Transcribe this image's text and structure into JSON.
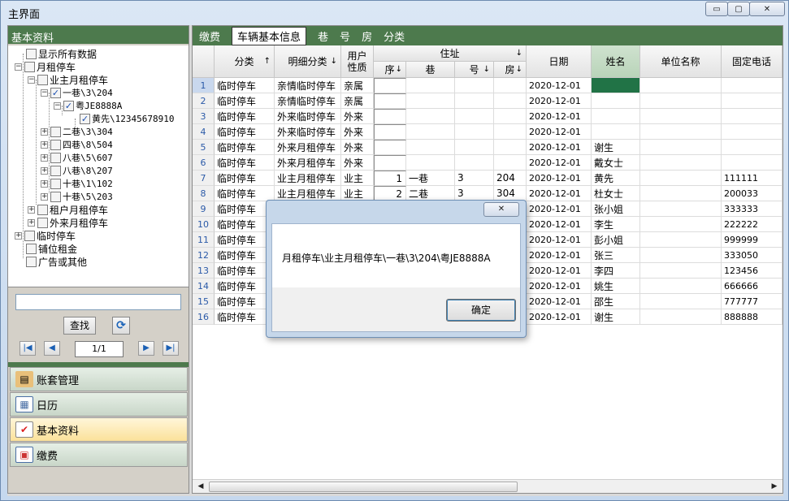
{
  "window": {
    "title": "主界面",
    "minimize_glyph": "▭",
    "maximize_glyph": "▢",
    "close_glyph": "✕"
  },
  "left": {
    "header": "基本资料",
    "tree": [
      {
        "label": "显示所有数据",
        "checked": false
      },
      {
        "label": "月租停车",
        "checked": false
      },
      {
        "label": "业主月租停车",
        "checked": false
      },
      {
        "label": "一巷\\3\\204",
        "checked": true
      },
      {
        "label": "粤JE8888A",
        "checked": true
      },
      {
        "label": "黄先\\12345678910",
        "checked": true
      },
      {
        "label": "二巷\\3\\304",
        "checked": false
      },
      {
        "label": "四巷\\8\\504",
        "checked": false
      },
      {
        "label": "八巷\\5\\607",
        "checked": false
      },
      {
        "label": "八巷\\8\\207",
        "checked": false
      },
      {
        "label": "十巷\\1\\102",
        "checked": false
      },
      {
        "label": "十巷\\5\\203",
        "checked": false
      },
      {
        "label": "租户月租停车",
        "checked": false
      },
      {
        "label": "外来月租停车",
        "checked": false
      },
      {
        "label": "临时停车",
        "checked": false
      },
      {
        "label": "铺位租金",
        "checked": false
      },
      {
        "label": "广告或其他",
        "checked": false
      }
    ],
    "search_value": "",
    "find_label": "查找",
    "refresh_glyph": "⟳",
    "nav_first": "|◀",
    "nav_prev": "◀",
    "nav_next": "▶",
    "nav_last": "▶|",
    "page_indicator": "1/1",
    "menu": [
      {
        "label": "账套管理",
        "icon": "ledger-icon"
      },
      {
        "label": "日历",
        "icon": "calendar-icon"
      },
      {
        "label": "基本资料",
        "icon": "checklist-icon"
      },
      {
        "label": "缴费",
        "icon": "payment-card-icon"
      }
    ]
  },
  "tabs": [
    "缴费",
    "车辆基本信息",
    "巷",
    "号",
    "房",
    "分类"
  ],
  "grid": {
    "headers": {
      "category": "分类",
      "detail": "明细分类",
      "user_type_1": "用户",
      "user_type_2": "性质",
      "address": "住址",
      "seq": "序",
      "lane": "巷",
      "number": "号",
      "room": "房",
      "date": "日期",
      "name": "姓名",
      "company": "单位名称",
      "phone": "固定电话"
    },
    "sort_up": "↑",
    "sort_down": "↓",
    "rows": [
      {
        "n": "1",
        "category": "临时停车",
        "detail": "亲情临时停车",
        "user": "亲属",
        "seq": "",
        "lane": "",
        "number": "",
        "room": "",
        "date": "2020-12-01",
        "name": "",
        "company": "",
        "phone": ""
      },
      {
        "n": "2",
        "category": "临时停车",
        "detail": "亲情临时停车",
        "user": "亲属",
        "seq": "",
        "lane": "",
        "number": "",
        "room": "",
        "date": "2020-12-01",
        "name": "",
        "company": "",
        "phone": ""
      },
      {
        "n": "3",
        "category": "临时停车",
        "detail": "外来临时停车",
        "user": "外来",
        "seq": "",
        "lane": "",
        "number": "",
        "room": "",
        "date": "2020-12-01",
        "name": "",
        "company": "",
        "phone": ""
      },
      {
        "n": "4",
        "category": "临时停车",
        "detail": "外来临时停车",
        "user": "外来",
        "seq": "",
        "lane": "",
        "number": "",
        "room": "",
        "date": "2020-12-01",
        "name": "",
        "company": "",
        "phone": ""
      },
      {
        "n": "5",
        "category": "临时停车",
        "detail": "外来月租停车",
        "user": "外来",
        "seq": "",
        "lane": "",
        "number": "",
        "room": "",
        "date": "2020-12-01",
        "name": "谢生",
        "company": "",
        "phone": ""
      },
      {
        "n": "6",
        "category": "临时停车",
        "detail": "外来月租停车",
        "user": "外来",
        "seq": "",
        "lane": "",
        "number": "",
        "room": "",
        "date": "2020-12-01",
        "name": "戴女士",
        "company": "",
        "phone": ""
      },
      {
        "n": "7",
        "category": "临时停车",
        "detail": "业主月租停车",
        "user": "业主",
        "seq": "1",
        "lane": "一巷",
        "number": "3",
        "room": "204",
        "date": "2020-12-01",
        "name": "黄先",
        "company": "",
        "phone": "111111"
      },
      {
        "n": "8",
        "category": "临时停车",
        "detail": "业主月租停车",
        "user": "业主",
        "seq": "2",
        "lane": "二巷",
        "number": "3",
        "room": "304",
        "date": "2020-12-01",
        "name": "杜女士",
        "company": "",
        "phone": "200033"
      },
      {
        "n": "9",
        "category": "临时停车",
        "detail": "",
        "user": "",
        "seq": "",
        "lane": "",
        "number": "",
        "room": "",
        "date": "2020-12-01",
        "name": "张小姐",
        "company": "",
        "phone": "333333"
      },
      {
        "n": "10",
        "category": "临时停车",
        "detail": "",
        "user": "",
        "seq": "",
        "lane": "",
        "number": "",
        "room": "",
        "date": "2020-12-01",
        "name": "李生",
        "company": "",
        "phone": "222222"
      },
      {
        "n": "11",
        "category": "临时停车",
        "detail": "",
        "user": "",
        "seq": "",
        "lane": "",
        "number": "",
        "room": "",
        "date": "2020-12-01",
        "name": "彭小姐",
        "company": "",
        "phone": "999999"
      },
      {
        "n": "12",
        "category": "临时停车",
        "detail": "",
        "user": "",
        "seq": "",
        "lane": "",
        "number": "",
        "room": "",
        "date": "2020-12-01",
        "name": "张三",
        "company": "",
        "phone": "333050"
      },
      {
        "n": "13",
        "category": "临时停车",
        "detail": "",
        "user": "",
        "seq": "",
        "lane": "",
        "number": "",
        "room": "",
        "date": "2020-12-01",
        "name": "李四",
        "company": "",
        "phone": "123456"
      },
      {
        "n": "14",
        "category": "临时停车",
        "detail": "",
        "user": "",
        "seq": "",
        "lane": "",
        "number": "",
        "room": "",
        "date": "2020-12-01",
        "name": "姚生",
        "company": "",
        "phone": "666666"
      },
      {
        "n": "15",
        "category": "临时停车",
        "detail": "",
        "user": "",
        "seq": "",
        "lane": "",
        "number": "",
        "room": "",
        "date": "2020-12-01",
        "name": "邵生",
        "company": "",
        "phone": "777777"
      },
      {
        "n": "16",
        "category": "临时停车",
        "detail": "",
        "user": "",
        "seq": "",
        "lane": "",
        "number": "",
        "room": "",
        "date": "2020-12-01",
        "name": "谢生",
        "company": "",
        "phone": "888888"
      }
    ]
  },
  "dialog": {
    "close_glyph": "✕",
    "message": "月租停车\\业主月租停车\\一巷\\3\\204\\粤JE8888A",
    "ok_label": "确定"
  },
  "colors": {
    "accent_green": "#4d7a4d",
    "selected_cell": "#217346",
    "active_menu": "#fbe19a"
  }
}
